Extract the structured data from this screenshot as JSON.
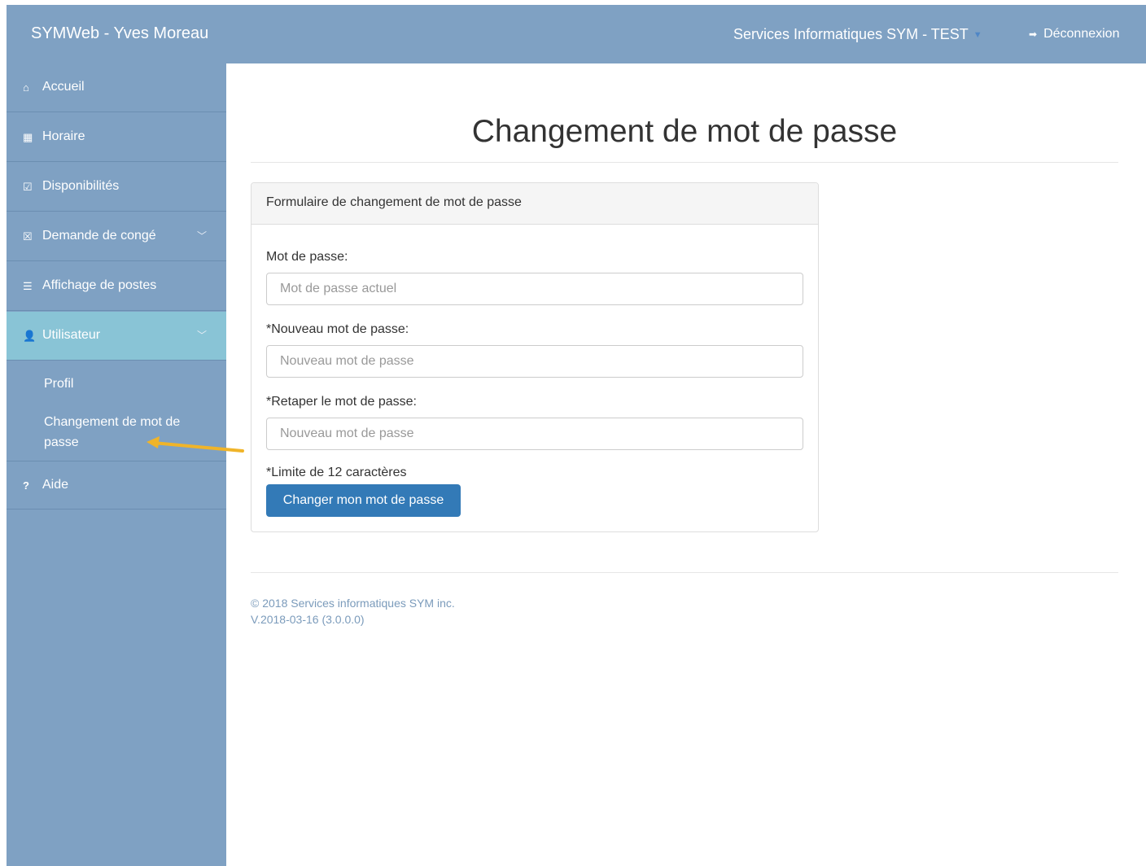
{
  "navbar": {
    "brand": "SYMWeb - Yves Moreau",
    "company": "Services Informatiques SYM - TEST",
    "logout": "Déconnexion"
  },
  "sidebar": {
    "items": [
      {
        "icon": "home-icon",
        "label": "Accueil"
      },
      {
        "icon": "calendar-icon",
        "label": "Horaire"
      },
      {
        "icon": "calendar-check-icon",
        "label": "Disponibilités"
      },
      {
        "icon": "calendar-x-icon",
        "label": "Demande de congé"
      },
      {
        "icon": "list-icon",
        "label": "Affichage de postes"
      },
      {
        "icon": "user-icon",
        "label": "Utilisateur"
      },
      {
        "icon": "question-icon",
        "label": "Aide"
      }
    ],
    "sub_items": [
      "Profil",
      "Changement de mot de passe"
    ]
  },
  "main": {
    "title": "Changement de mot de passe",
    "panel_title": "Formulaire de changement de mot de passe",
    "fields": [
      {
        "label": "Mot de passe:",
        "placeholder": "Mot de passe actuel"
      },
      {
        "label": "*Nouveau mot de passe:",
        "placeholder": "Nouveau mot de passe"
      },
      {
        "label": "*Retaper le mot de passe:",
        "placeholder": "Nouveau mot de passe"
      }
    ],
    "limit_note": "*Limite de 12 caractères",
    "submit_label": "Changer mon mot de passe"
  },
  "footer": {
    "copyright": "© 2018 Services informatiques SYM inc.",
    "version": "V.2018-03-16 (3.0.0.0)"
  },
  "colors": {
    "navbar": "#7fa1c3",
    "active_item": "#89c4d6",
    "primary_button": "#337ab7",
    "annotation_arrow": "#f0b429"
  }
}
